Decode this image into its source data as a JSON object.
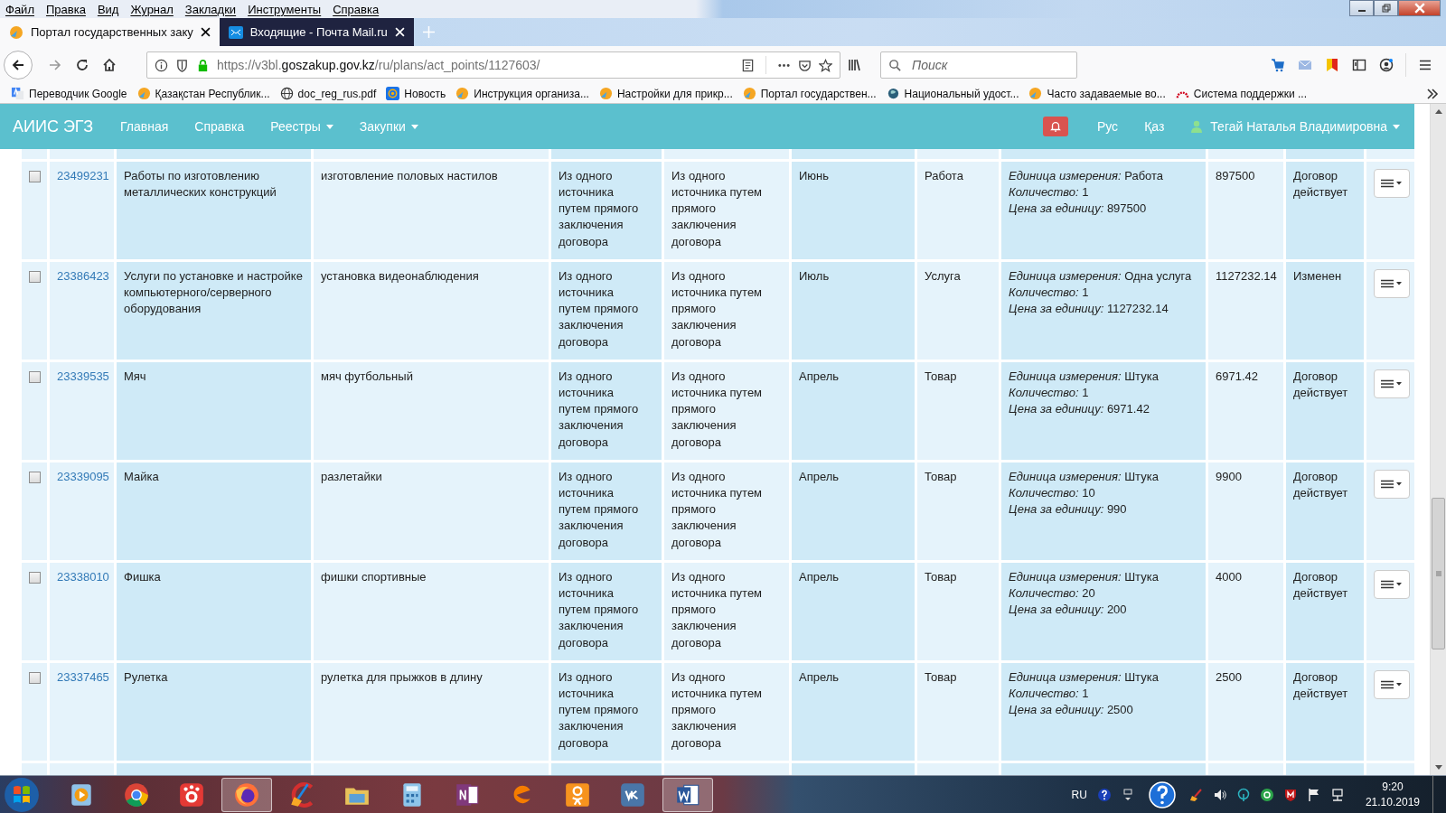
{
  "menu_bar": [
    "Файл",
    "Правка",
    "Вид",
    "Журнал",
    "Закладки",
    "Инструменты",
    "Справка"
  ],
  "tabs": [
    {
      "title": "Портал государственных заку",
      "selected": true,
      "kind": "sun"
    },
    {
      "title": "Входящие - Почта Mail.ru",
      "selected": false,
      "kind": "mail"
    }
  ],
  "address": {
    "url_parts": [
      "https://v3bl.",
      "goszakup.gov.kz",
      "/ru/plans/act_points/1127603/"
    ]
  },
  "search": {
    "placeholder": "Поиск"
  },
  "bookmarks": [
    {
      "label": "Переводчик Google",
      "kind": "translate"
    },
    {
      "label": "Қазақстан Республик...",
      "kind": "sun"
    },
    {
      "label": "doc_reg_rus.pdf",
      "kind": "globe"
    },
    {
      "label": "Новость",
      "kind": "at"
    },
    {
      "label": "Инструкция организа...",
      "kind": "sun"
    },
    {
      "label": "Настройки для прикр...",
      "kind": "sun"
    },
    {
      "label": "Портал государствен...",
      "kind": "sun"
    },
    {
      "label": "Национальный удост...",
      "kind": "planet"
    },
    {
      "label": "Часто задаваемые во...",
      "kind": "sun"
    },
    {
      "label": "Система поддержки ...",
      "kind": "arc"
    }
  ],
  "site": {
    "brand": "АИИС ЭГЗ",
    "nav": [
      {
        "label": "Главная",
        "dropdown": false
      },
      {
        "label": "Справка",
        "dropdown": false
      },
      {
        "label": "Реестры",
        "dropdown": true
      },
      {
        "label": "Закупки",
        "dropdown": true
      }
    ],
    "languages": [
      "Рус",
      "Қаз"
    ],
    "user": "Тегай Наталья Владимировна"
  },
  "rows": [
    {
      "checked": false,
      "id": "23499231",
      "name": "Работы по изготовлению металлических конструкций",
      "description": "изготовление половых настилов",
      "method_1": "Из одного источника путем прямого заключения договора",
      "method_2": "Из одного источника путем прямого заключения договора",
      "month": "Июнь",
      "type": "Работа",
      "units": [
        "*Единица измерения:* Работа",
        "*Количество:* 1",
        "*Цена за единицу:* 897500"
      ],
      "sum": "897500",
      "status": "Договор действует"
    },
    {
      "checked": false,
      "id": "23386423",
      "name": "Услуги по установке и настройке компьютерного/серверного оборудования",
      "description": "установка видеонаблюдения",
      "method_1": "Из одного источника путем прямого заключения договора",
      "method_2": "Из одного источника путем прямого заключения договора",
      "month": "Июль",
      "type": "Услуга",
      "units": [
        "*Единица измерения:* Одна услуга",
        "*Количество:* 1",
        "*Цена за единицу:* 1127232.14"
      ],
      "sum": "1127232.14",
      "status": "Изменен"
    },
    {
      "checked": false,
      "id": "23339535",
      "name": "Мяч",
      "description": "мяч футбольный",
      "method_1": "Из одного источника путем прямого заключения договора",
      "method_2": "Из одного источника путем прямого заключения договора",
      "month": "Апрель",
      "type": "Товар",
      "units": [
        "*Единица измерения:* Штука",
        "*Количество:* 1",
        "*Цена за единицу:* 6971.42"
      ],
      "sum": "6971.42",
      "status": "Договор действует"
    },
    {
      "checked": false,
      "id": "23339095",
      "name": "Майка",
      "description": "разлетайки",
      "method_1": "Из одного источника путем прямого заключения договора",
      "method_2": "Из одного источника путем прямого заключения договора",
      "month": "Апрель",
      "type": "Товар",
      "units": [
        "*Единица измерения:* Штука",
        "*Количество:* 10",
        "*Цена за единицу:* 990"
      ],
      "sum": "9900",
      "status": "Договор действует"
    },
    {
      "checked": false,
      "id": "23338010",
      "name": "Фишка",
      "description": "фишки спортивные",
      "method_1": "Из одного источника путем прямого заключения договора",
      "method_2": "Из одного источника путем прямого заключения договора",
      "month": "Апрель",
      "type": "Товар",
      "units": [
        "*Единица измерения:* Штука",
        "*Количество:* 20",
        "*Цена за единицу:* 200"
      ],
      "sum": "4000",
      "status": "Договор действует"
    },
    {
      "checked": false,
      "id": "23337465",
      "name": "Рулетка",
      "description": "рулетка для прыжков в длину",
      "method_1": "Из одного источника путем прямого заключения договора",
      "method_2": "Из одного источника путем прямого заключения договора",
      "month": "Апрель",
      "type": "Товар",
      "units": [
        "*Единица измерения:* Штука",
        "*Количество:* 1",
        "*Цена за единицу:* 2500"
      ],
      "sum": "2500",
      "status": "Договор действует"
    }
  ],
  "taskbar": {
    "apps": [
      {
        "kind": "player",
        "open": false
      },
      {
        "kind": "chrome",
        "open": false
      },
      {
        "kind": "camera",
        "open": false
      },
      {
        "kind": "firefox",
        "open": true
      },
      {
        "kind": "cleaner",
        "open": false
      },
      {
        "kind": "folder",
        "open": false
      },
      {
        "kind": "calculator",
        "open": false
      },
      {
        "kind": "note",
        "open": false
      },
      {
        "kind": "browser",
        "open": false
      },
      {
        "kind": "social",
        "open": false
      },
      {
        "kind": "vk",
        "open": false
      },
      {
        "kind": "word",
        "open": true
      }
    ],
    "language": "RU",
    "time": "9:20",
    "date": "21.10.2019"
  }
}
